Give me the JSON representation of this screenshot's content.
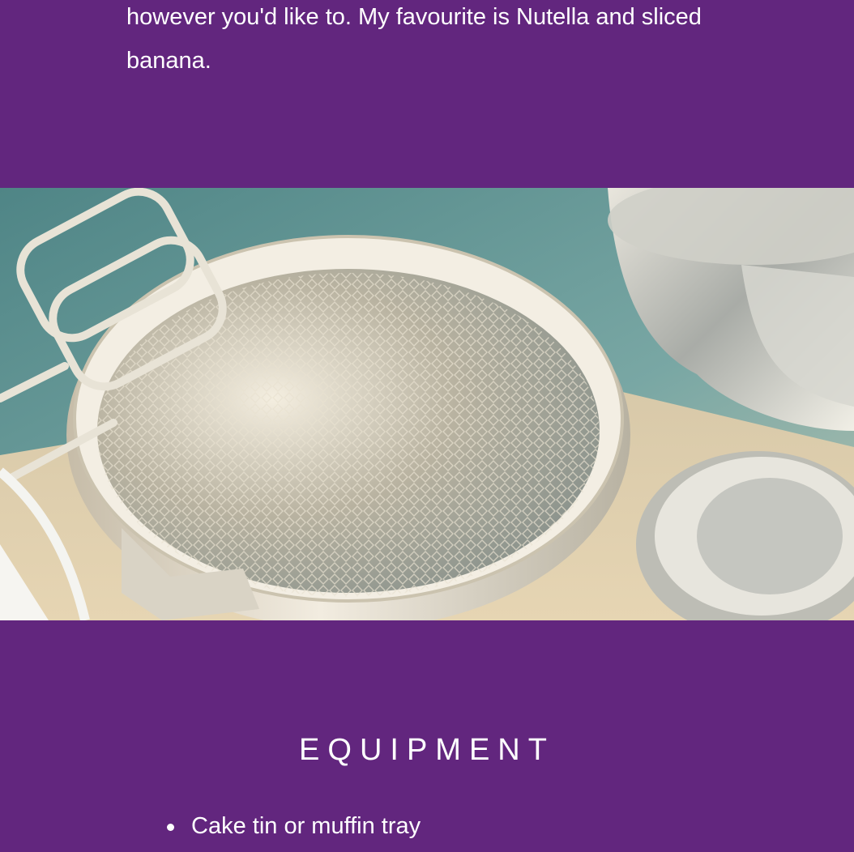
{
  "intro": {
    "text": "however you'd like to. My favourite is Nutella and sliced banana."
  },
  "hero_image": {
    "icon": "cake-tin-photo"
  },
  "equipment": {
    "title": "EQUIPMENT",
    "items": [
      "Cake tin or muffin tray"
    ]
  },
  "colors": {
    "background": "#62267e",
    "text": "#ffffff"
  }
}
